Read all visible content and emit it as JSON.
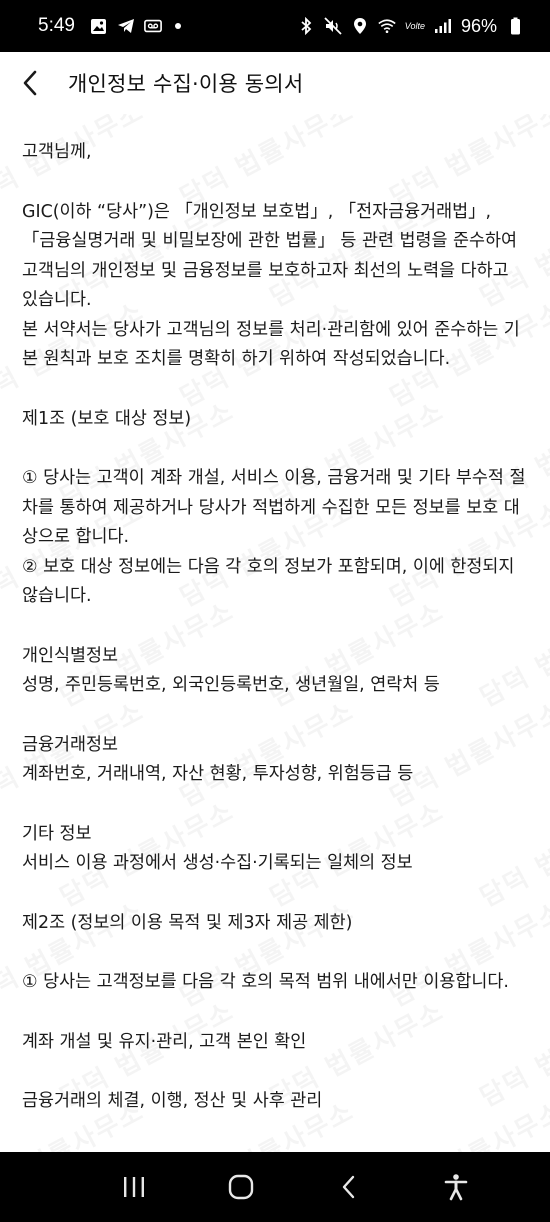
{
  "status_bar": {
    "time": "5:49",
    "volte_label": "Volte",
    "battery": "96%",
    "icons": [
      "gallery-icon",
      "telegram-icon",
      "voicemail-icon",
      "dot-icon",
      "bluetooth-icon",
      "mute-icon",
      "location-icon",
      "wifi-icon",
      "signal-icon",
      "battery-icon"
    ]
  },
  "header": {
    "title": "개인정보 수집·이용 동의서",
    "back_icon": "chevron-left-icon"
  },
  "document": {
    "greeting": "고객님께,",
    "intro_1": "GIC(이하 “당사”)은 「개인정보 보호법」, 「전자금융거래법」, 「금융실명거래 및 비밀보장에 관한 법률」 등 관련 법령을 준수하여 고객님의 개인정보 및 금융정보를 보호하고자 최선의 노력을 다하고 있습니다.",
    "intro_2": "본 서약서는 당사가 고객님의 정보를 처리·관리함에 있어 준수하는 기본 원칙과 보호 조치를 명확히 하기 위하여 작성되었습니다.",
    "article1_title": "제1조 (보호 대상 정보)",
    "article1_p1": "① 당사는 고객이 계좌 개설, 서비스 이용, 금융거래 및 기타 부수적 절차를 통하여 제공하거나 당사가 적법하게 수집한 모든 정보를 보호 대상으로 합니다.",
    "article1_p2": "② 보호 대상 정보에는 다음 각 호의 정보가 포함되며, 이에 한정되지 않습니다.",
    "cat1_title": "개인식별정보",
    "cat1_items": "성명, 주민등록번호, 외국인등록번호, 생년월일, 연락처 등",
    "cat2_title": "금융거래정보",
    "cat2_items": "계좌번호, 거래내역, 자산 현황, 투자성향, 위험등급 등",
    "cat3_title": "기타 정보",
    "cat3_items": "서비스 이용 과정에서 생성·수집·기록되는 일체의 정보",
    "article2_title": "제2조 (정보의 이용 목적 및 제3자 제공 제한)",
    "article2_p1": "① 당사는 고객정보를 다음 각 호의 목적 범위 내에서만 이용합니다.",
    "purpose1": "계좌 개설 및 유지·관리, 고객 본인 확인",
    "purpose2_partial": "금융거래의 체결, 이행, 정산 및 사후 관리"
  },
  "watermark": {
    "text": "담덕 법률사무소"
  },
  "nav_bar": {
    "recents_icon": "recents-icon",
    "home_icon": "home-icon",
    "back_icon": "back-icon",
    "accessibility_icon": "accessibility-icon"
  },
  "colors": {
    "background": "#ffffff",
    "text": "#1b1b1b",
    "bars": "#000000"
  }
}
